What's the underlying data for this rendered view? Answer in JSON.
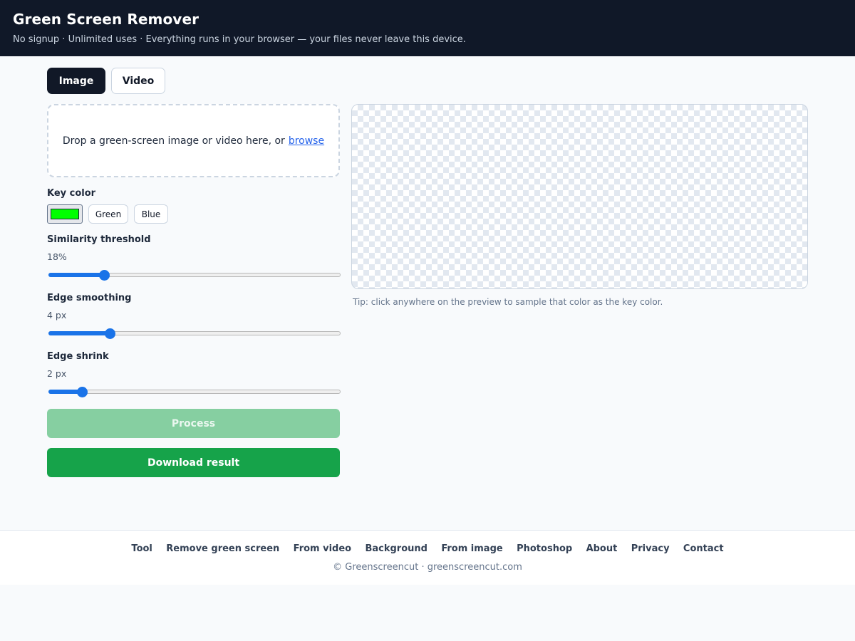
{
  "header": {
    "title": "Green Screen Remover",
    "subtitle": "No signup · Unlimited uses · Everything runs in your browser — your files never leave this device."
  },
  "tabs": [
    {
      "label": "Image",
      "active": true
    },
    {
      "label": "Video",
      "active": false
    }
  ],
  "dropzone": {
    "text": "Drop a green-screen image or video here, or",
    "link": "browse"
  },
  "key_color": {
    "label": "Key color",
    "value": "#00ff00",
    "presets": [
      "Green",
      "Blue"
    ]
  },
  "controls": {
    "similarity": {
      "label": "Similarity threshold",
      "display": "18%",
      "fraction": 0.19
    },
    "smoothing": {
      "label": "Edge smoothing",
      "display": "4 px",
      "fraction": 0.21
    },
    "shrink": {
      "label": "Edge shrink",
      "display": "2 px",
      "fraction": 0.115
    }
  },
  "buttons": {
    "process": "Process",
    "download": "Download result"
  },
  "preview": {
    "tip": "Tip: click anywhere on the preview to sample that color as the key color."
  },
  "footer": {
    "links": [
      "Tool",
      "Remove green screen",
      "From video",
      "Background",
      "From image",
      "Photoshop",
      "About",
      "Privacy",
      "Contact"
    ],
    "copyright": "© Greenscreencut · greenscreencut.com"
  },
  "colors": {
    "header_bg": "#101828",
    "accent": "#16a34a",
    "slider": "#1a73e8"
  }
}
